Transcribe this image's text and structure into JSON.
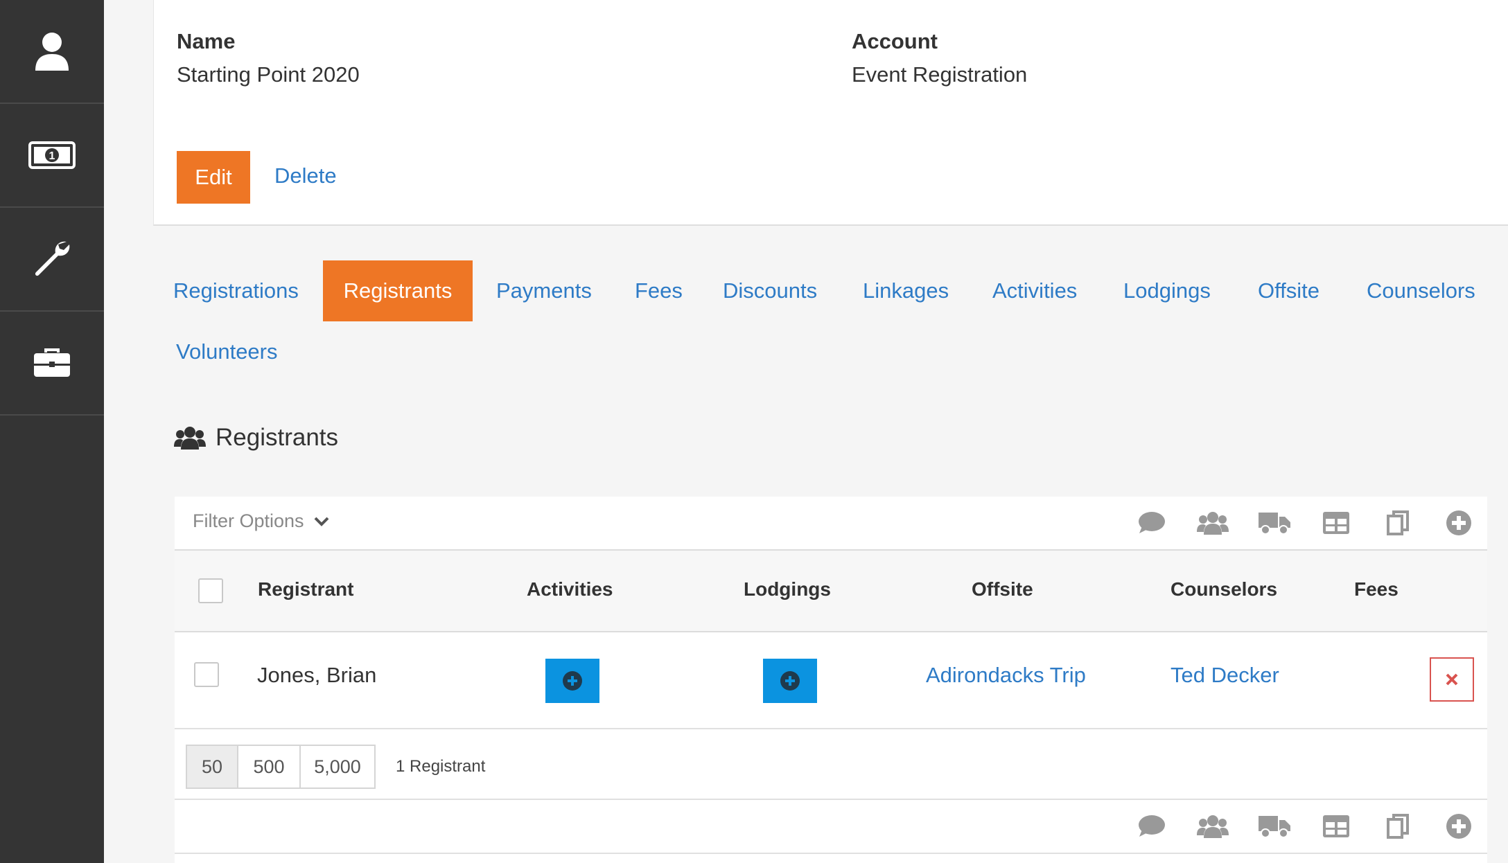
{
  "sidebar": {
    "items": [
      {
        "icon": "user-icon"
      },
      {
        "icon": "money-icon"
      },
      {
        "icon": "wrench-icon"
      },
      {
        "icon": "briefcase-icon"
      }
    ]
  },
  "details": {
    "name_label": "Name",
    "name_value": "Starting Point 2020",
    "account_label": "Account",
    "account_value": "Event Registration",
    "edit_label": "Edit",
    "delete_label": "Delete"
  },
  "tabs": [
    {
      "label": "Registrations",
      "active": false
    },
    {
      "label": "Registrants",
      "active": true
    },
    {
      "label": "Payments",
      "active": false
    },
    {
      "label": "Fees",
      "active": false
    },
    {
      "label": "Discounts",
      "active": false
    },
    {
      "label": "Linkages",
      "active": false
    },
    {
      "label": "Activities",
      "active": false
    },
    {
      "label": "Lodgings",
      "active": false
    },
    {
      "label": "Offsite",
      "active": false
    },
    {
      "label": "Counselors",
      "active": false
    },
    {
      "label": "Volunteers",
      "active": false
    }
  ],
  "section": {
    "title": "Registrants",
    "icon": "users-icon"
  },
  "grid": {
    "filter_label": "Filter Options",
    "toolbar_icons": [
      "comment-icon",
      "users-icon",
      "truck-icon",
      "table-icon",
      "copy-icon",
      "add-icon"
    ],
    "columns": [
      "Registrant",
      "Activities",
      "Lodgings",
      "Offsite",
      "Counselors",
      "Fees"
    ],
    "rows": [
      {
        "registrant": "Jones, Brian",
        "offsite": "Adirondacks Trip",
        "counselor": "Ted Decker",
        "fees": ""
      }
    ],
    "page_sizes": [
      "50",
      "500",
      "5,000"
    ],
    "active_page_size": "50",
    "count_text": "1 Registrant"
  },
  "colors": {
    "accent": "#ee7625",
    "link": "#2e7bc6",
    "sidebar": "#343434",
    "blue_button": "#0b93e0",
    "danger": "#d9534f"
  }
}
